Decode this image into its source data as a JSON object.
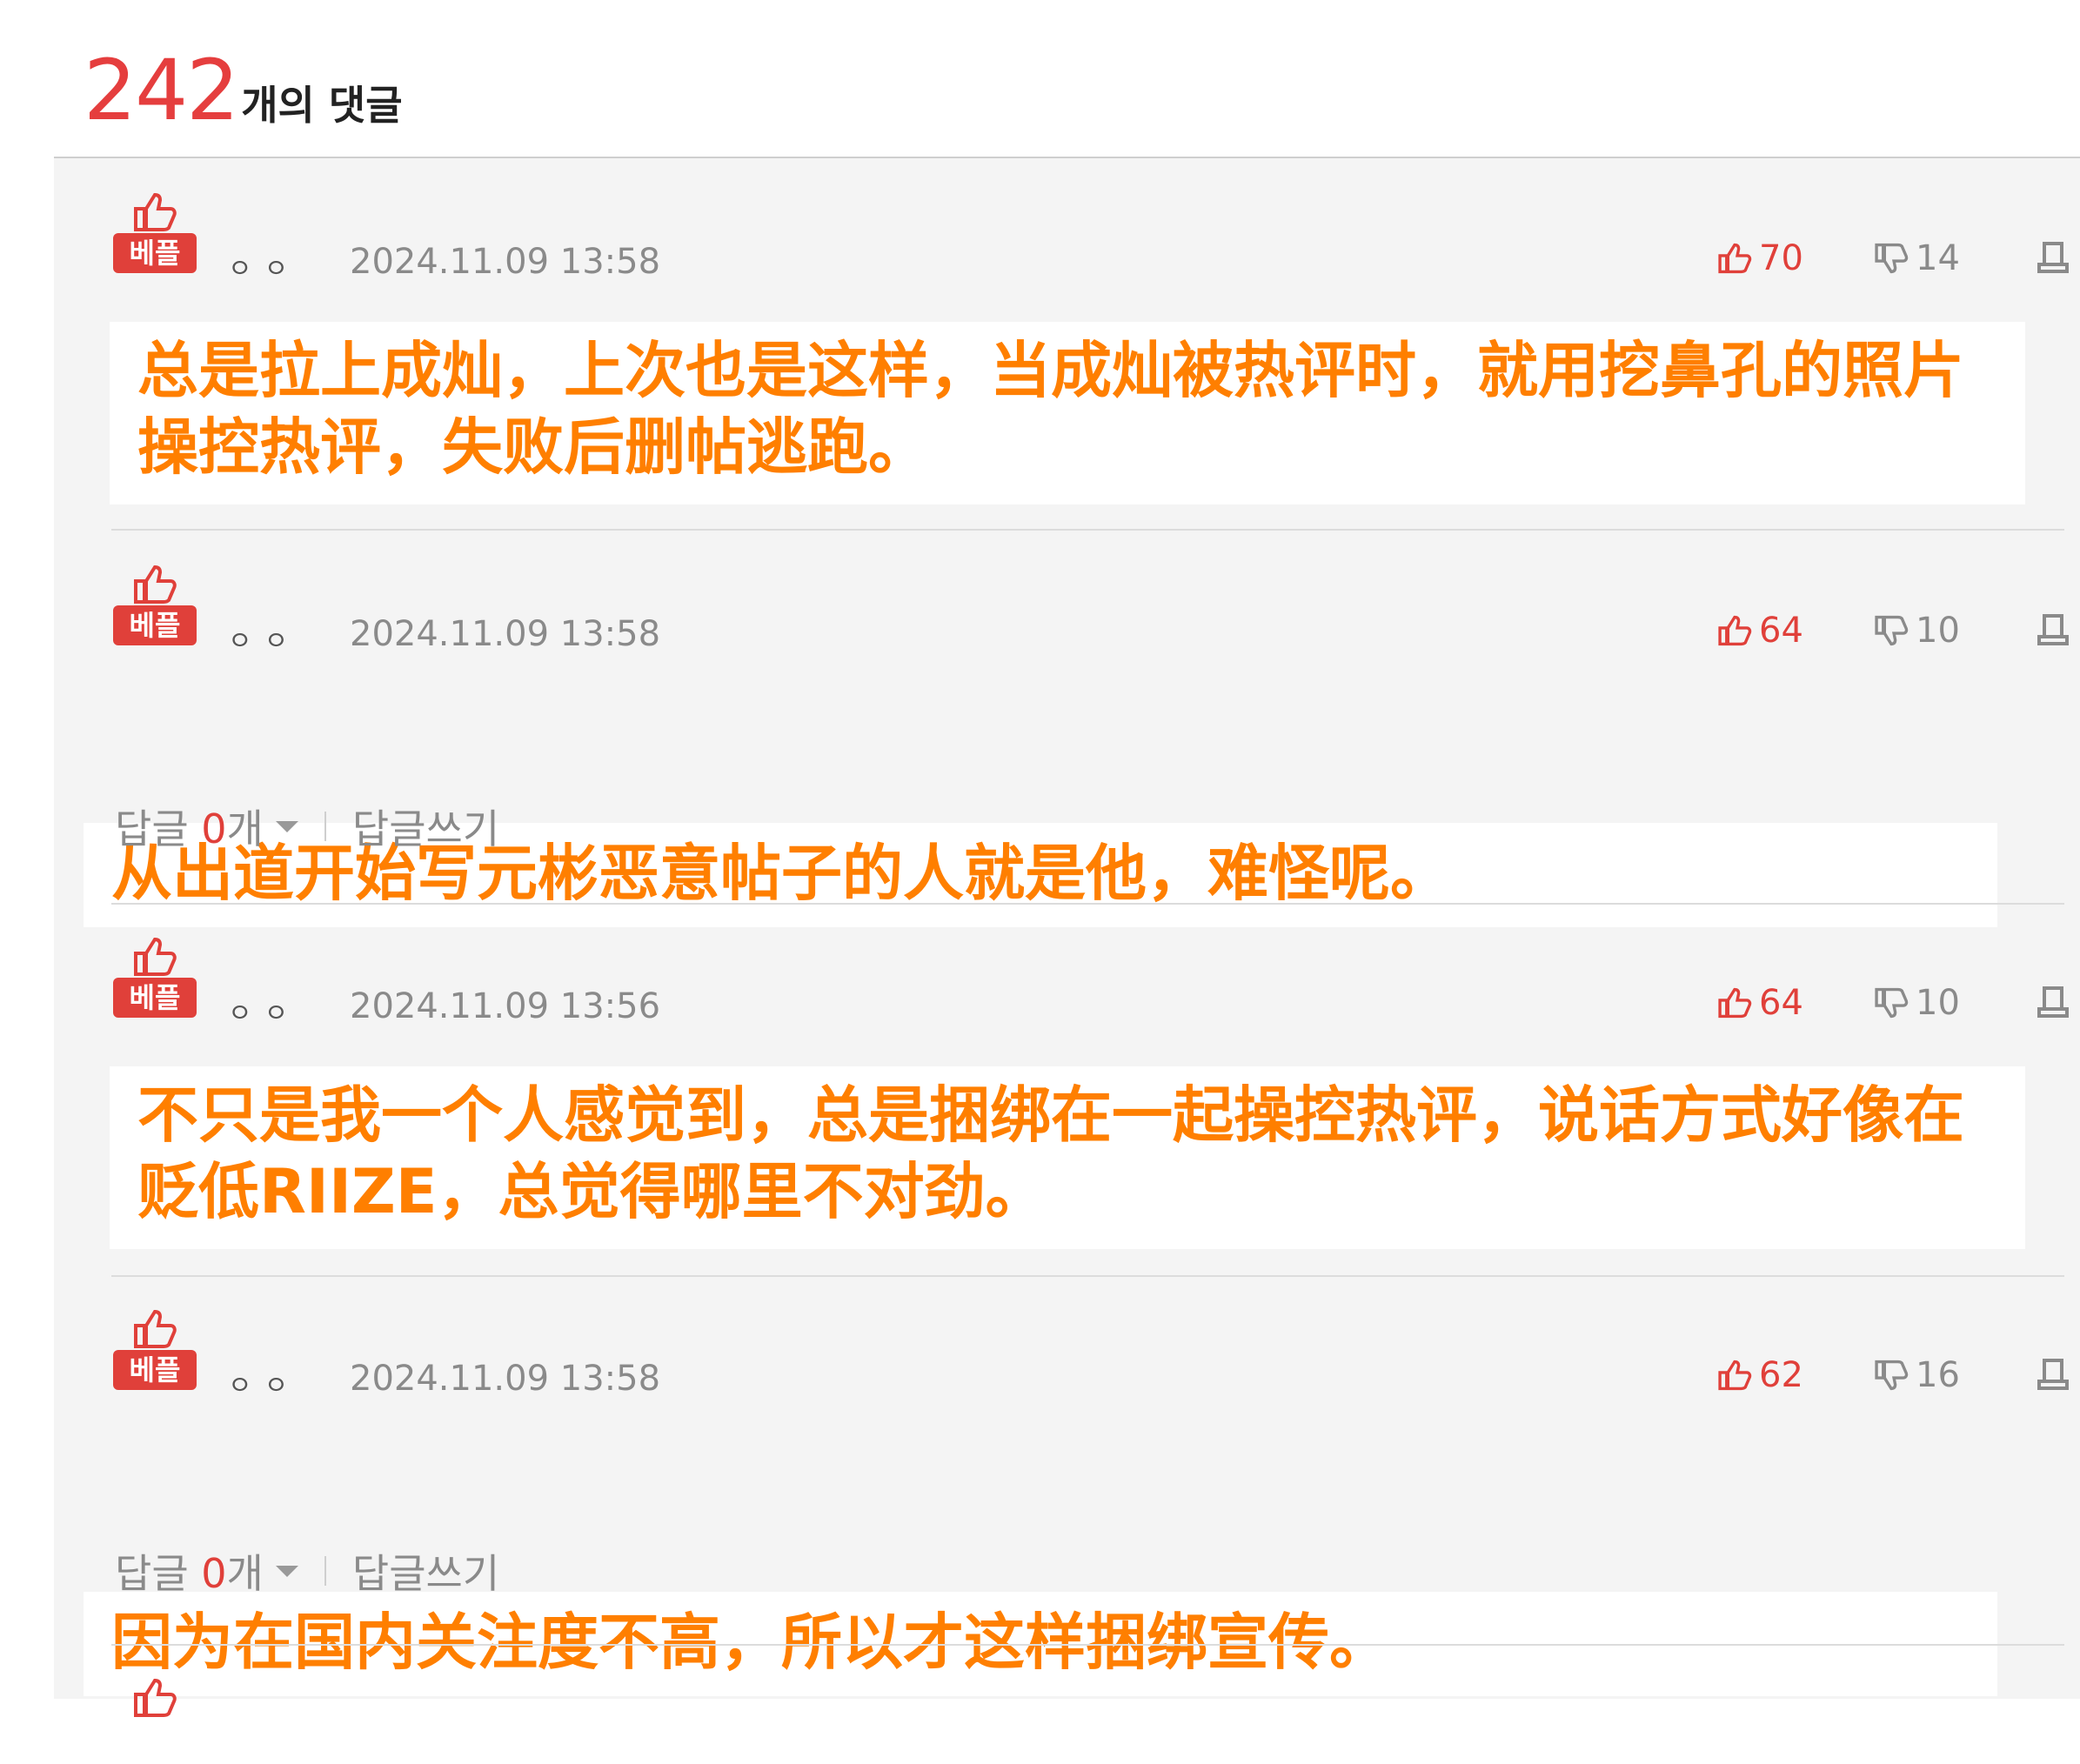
{
  "header": {
    "count": "242",
    "label": "개의 댓글"
  },
  "comments": [
    {
      "badge": "베플",
      "nick": "ㅇㅇ",
      "date": "2024.11.09 13:58",
      "up": "70",
      "down": "14",
      "text": "总是拉上成灿，上次也是这样，当成灿被热评时，就用挖鼻孔的照片操控热评，失败后删帖逃跑。"
    },
    {
      "badge": "베플",
      "nick": "ㅇㅇ",
      "date": "2024.11.09 13:58",
      "up": "64",
      "down": "10",
      "text": "从出道开始写元彬恶意帖子的人就是他，难怪呢。"
    },
    {
      "badge": "베플",
      "nick": "ㅇㅇ",
      "date": "2024.11.09 13:56",
      "up": "64",
      "down": "10",
      "text": "不只是我一个人感觉到，总是捆绑在一起操控热评，说话方式好像在贬低RIIZE，总觉得哪里不对劲。"
    },
    {
      "badge": "베플",
      "nick": "ㅇㅇ",
      "date": "2024.11.09 13:58",
      "up": "62",
      "down": "16",
      "text": "因为在国内关注度不高，所以才这样捆绑宣传。"
    }
  ],
  "reply": {
    "label": "답글",
    "count": "0",
    "unit": "개",
    "write": "답글쓰기"
  },
  "colors": {
    "accent": "#e0403a",
    "body_text": "#ff7f00",
    "panel": "#f4f4f4"
  }
}
